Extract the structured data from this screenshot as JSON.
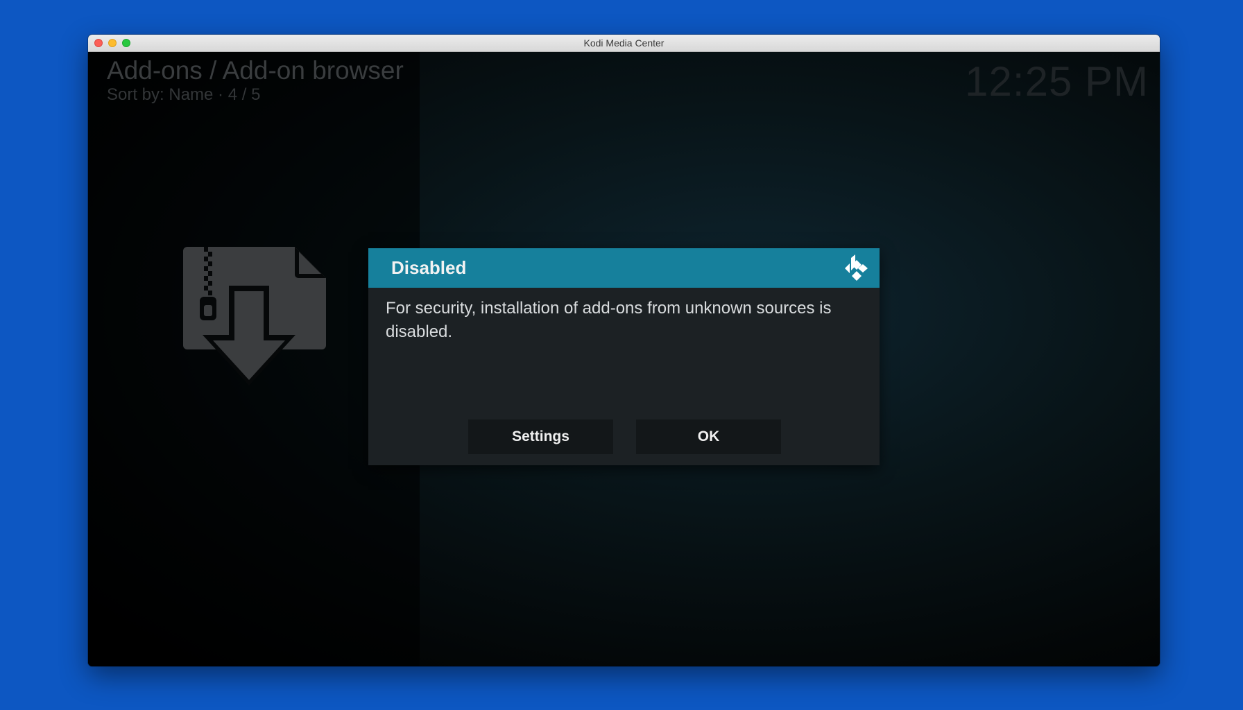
{
  "window": {
    "title": "Kodi Media Center"
  },
  "header": {
    "breadcrumb": "Add-ons / Add-on browser",
    "sort_info": "Sort by: Name  ·  4 / 5",
    "clock": "12:25 PM"
  },
  "main": {
    "item_icon": "zip-download-icon"
  },
  "dialog": {
    "title": "Disabled",
    "logo_icon": "kodi-logo-icon",
    "message": "For security, installation of add-ons from unknown sources is disabled.",
    "buttons": {
      "settings_label": "Settings",
      "ok_label": "OK"
    }
  },
  "colors": {
    "desktop_background": "#0d57c2",
    "dialog_header": "#16809c",
    "dialog_body": "#1c2124",
    "button_background": "#131719"
  }
}
